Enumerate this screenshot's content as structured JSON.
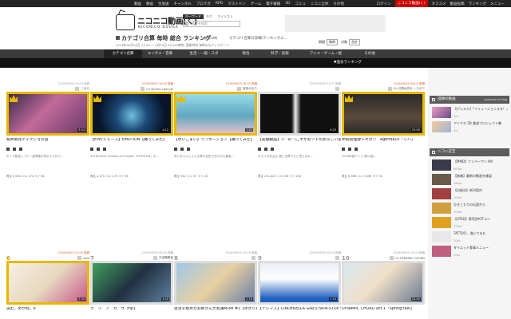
{
  "topbar": {
    "links": [
      "動画",
      "静画",
      "生放送",
      "チャンネル",
      "ブロマガ",
      "RPG",
      "マストドン",
      "ゲーム",
      "電子書籍",
      "3D",
      "コミュ",
      "ニコニ立体",
      "その他"
    ],
    "right": [
      "ログイン",
      "ニコニコ動画(く)",
      "オススメ",
      "動画投稿",
      "ランキング",
      "メニュー"
    ]
  },
  "header": {
    "logo": "ニコニコ動画(く)",
    "logo_sub": "NICONICO DOUGA",
    "search_tabs": [
      "キーワード",
      "タグ",
      "マイリスト"
    ],
    "search_placeholder": "動画を検索",
    "title": "カテゴリ合算 毎時 総合 ランキング",
    "period": "過去24時",
    "rules": "カテゴリ合算の詳細/ランキングに...",
    "update": "2018年09月05日 21:00 〜 9月05日 22:00(毎時) 更新時刻 毎時0分/アップデート",
    "controls": [
      {
        "label": "期間",
        "value": "毎時"
      },
      {
        "label": "対象",
        "value": "合計"
      }
    ]
  },
  "catnav": {
    "tabs": [
      "カテゴリ合算",
      "エンタメ・音楽",
      "生活・一般・スポ",
      "政治",
      "科学・技術",
      "アニメ・ゲーム・絵",
      "その他"
    ]
  },
  "subnav": {
    "label": "▼過去ランキング"
  },
  "cards": [
    {
      "rank": "1",
      "date": "2018/09/05 21:00 投稿",
      "owner": "こゆら",
      "length": "3:04",
      "title": "葵井紫苑ティクショの話",
      "desc": "ネトゲ配信してた一部界隈が荒れてた件で...",
      "stats": "再生 8,054  コメ 174  マイ 64",
      "red": false
    },
    {
      "rank": "2",
      "date": "2018/09/05 18:00 投稿",
      "owner": "Ch @cutie channel",
      "length": "4:12",
      "title": "【EVE/ミューコ】EMOTION【踊ってみた】",
      "desc": "2018/09/05 release 2nd single「EMOTION」の...",
      "stats": "再生 2,270  コメ 170  マイ 94",
      "red": true
    },
    {
      "rank": "3",
      "date": "2018/09/05 18:00 投稿",
      "owner": "官邸のなり",
      "length": "1:44",
      "title": "【ゆいこまい】ラブポーション【踊ってみた】",
      "desc": "赤いちゃんとうえる等の目的で作られた動画...",
      "stats": "再生 942  コメ 57  マイ 20",
      "red": true
    },
    {
      "rank": "4",
      "date": "2018/09/05 21:37 投稿",
      "owner": "",
      "length": "0:23",
      "title": "【実験動画】イ^ω^)こすかおソトの恐ろしい実験【手記】",
      "desc": "キモイ光玄太王  超と世界でもと思えるの...",
      "stats": "再生 211,843  コメ 316  マイ 230",
      "red": false
    },
    {
      "rank": "5",
      "date": "2018/09/05 00:00 投稿",
      "owner": "Ch 幻想水滸伝 トネガワ",
      "length": "25:00",
      "title": "中間管理録トネガワ　Agenda10「リハ」",
      "desc": "2018年夏アニメ 第10話...",
      "stats": "再生 8,906  コメ 1,056  マイ 54",
      "red": true
    },
    {
      "rank": "6",
      "date": "2018/09/03 22:00 投稿",
      "owner": "Aiea",
      "length": "3:00",
      "title": "読む。めかね。6",
      "desc": "",
      "stats": "",
      "red": true
    },
    {
      "rank": "7",
      "date": "2018/09/04 00:00 投稿",
      "owner": "宇宙職業者",
      "length": "3:40",
      "title": "ク　リ　ア　カ　サ .mp1",
      "desc": "",
      "stats": "",
      "red": false
    },
    {
      "rank": "8",
      "date": "2018/09/05 10:30 投稿",
      "owner": "",
      "length": "1:18",
      "title": "就活を始めたお姉さんが会議MOM #1【ゆかり系鬼畜なみらいほ】",
      "desc": "",
      "stats": "",
      "red": false
    },
    {
      "rank": "9",
      "date": "2018/09/05 00:00 投稿",
      "owner": "",
      "length": "1:10",
      "title": "【デレマス】CINDERELLA GIRLS NON-STOP SPECIAL MIX 30",
      "desc": "",
      "stats": "",
      "red": false
    },
    {
      "rank": "10",
      "date": "2018/09/05 20:00 投稿",
      "owner": "Ch DYNAMIC CHORD",
      "length": "24:00",
      "title": "DYNAMIC CHORD act.1「Spring rain」",
      "desc": "",
      "stats": "",
      "red": false
    }
  ],
  "sidebar": {
    "section1": {
      "title": "話題の動画",
      "by": "powered by Nog"
    },
    "items1": [
      {
        "text": "【デレステ】「イリュージョニスタ！」MV",
        "pt": "3pt"
      },
      {
        "text": "アイマス 3D 美波プロジェクト集",
        "pt": "2pt"
      }
    ],
    "section2": {
      "title": "ニコニ広告"
    },
    "items2": [
      {
        "text": "【MMD】ナンバーワン MV",
        "pt": "600pt"
      },
      {
        "text": "【新着】最新の動画を確認",
        "pt": "160pt"
      },
      {
        "text": "【白紙化】新刊案内",
        "pt": "100pt"
      },
      {
        "text": "ひきこもりの伝説から",
        "pt": "100pt"
      },
      {
        "text": "【UTAU】第5回HOTコン",
        "pt": "100pt"
      },
      {
        "text": "TATTOO... 描いてみた",
        "pt": "20pt"
      },
      {
        "text": "ダイエット食事メニュー",
        "pt": "20pt"
      }
    ]
  }
}
